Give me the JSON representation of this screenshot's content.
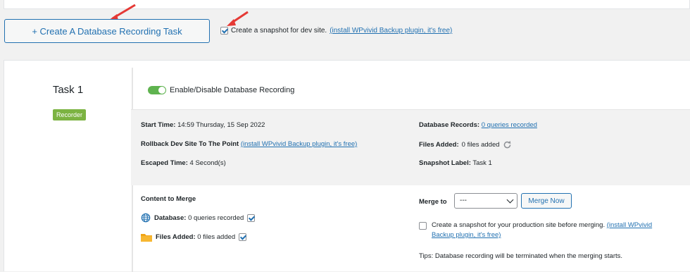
{
  "create_task": {
    "button_label": "+ Create A Database Recording Task",
    "snapshot_checkbox_label": "Create a snapshot for dev site.",
    "snapshot_checkbox_checked": true,
    "install_link": "(install WPvivid Backup plugin, it's free)"
  },
  "task": {
    "name": "Task 1",
    "badge": "Recorder",
    "toggle_label": "Enable/Disable Database Recording",
    "toggle_on": true,
    "info": {
      "start_time_label": "Start Time:",
      "start_time_value": "14:59 Thursday, 15 Sep 2022",
      "rollback_label": "Rollback Dev Site To The Point",
      "rollback_link": "(install WPvivid Backup plugin, it's free)",
      "escaped_label": "Escaped Time:",
      "escaped_value": "4 Second(s)",
      "db_records_label": "Database Records:",
      "db_records_link": "0 queries recorded",
      "files_added_label": "Files Added:",
      "files_added_value": "0 files added",
      "snapshot_label_label": "Snapshot Label:",
      "snapshot_label_value": "Task 1"
    },
    "merge": {
      "title": "Content to Merge",
      "database_label": "Database:",
      "database_value": "0 queries recorded",
      "database_checked": true,
      "files_label": "Files Added:",
      "files_value": "0 files added",
      "files_checked": true,
      "merge_to_label": "Merge to",
      "merge_to_selected": "---",
      "merge_now_label": "Merge Now",
      "prod_snapshot_text": "Create a snapshot for your production site before merging.",
      "prod_snapshot_link": "(install WPvivid Backup plugin, it's free)",
      "prod_snapshot_checked": false,
      "tips": "Tips: Database recording will be terminated when the merging starts."
    }
  },
  "colors": {
    "accent": "#2271b1",
    "badge_green": "#7cb342",
    "toggle_green": "#5fb34f",
    "arrow_red": "#e53935",
    "folder_orange": "#f0a416"
  },
  "icons": [
    "red-arrow-icon",
    "refresh-icon",
    "globe-icon",
    "folder-icon",
    "checkbox-check-icon",
    "chevron-down-icon"
  ]
}
